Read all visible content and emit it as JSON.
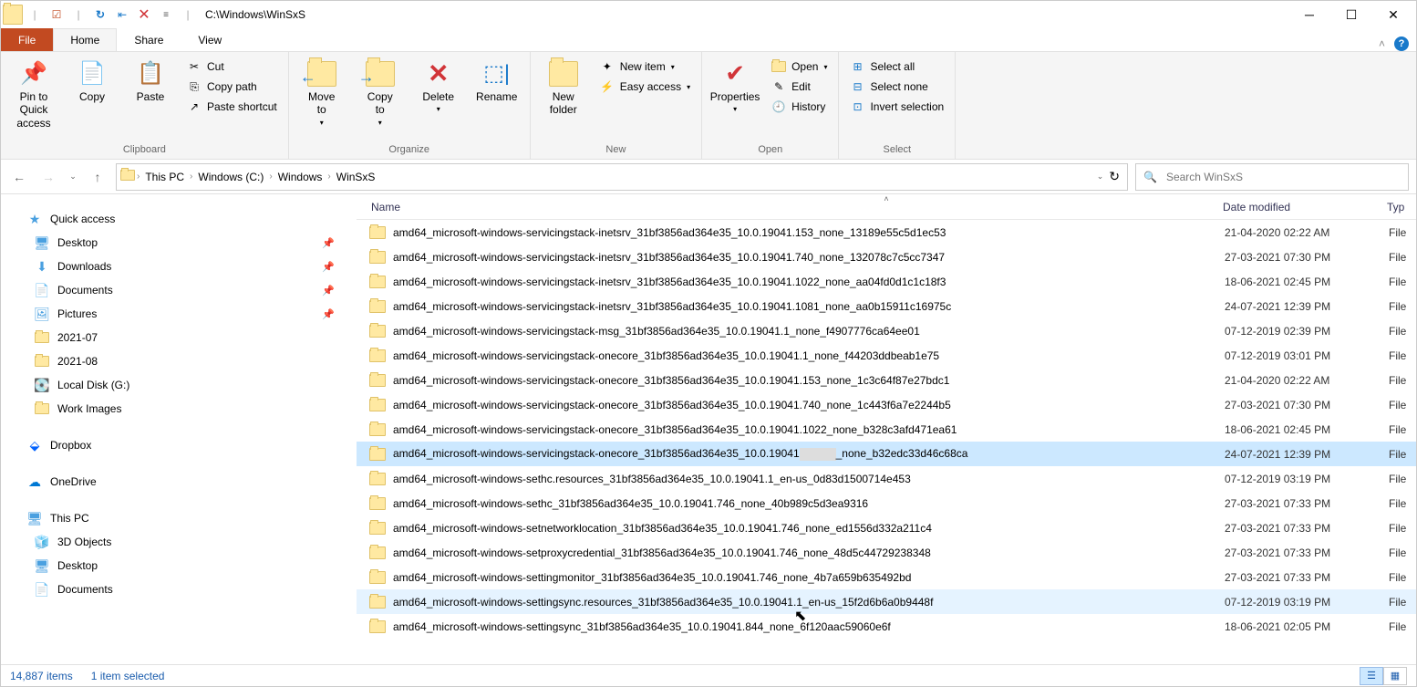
{
  "window": {
    "title_path": "C:\\Windows\\WinSxS"
  },
  "tabs": {
    "file": "File",
    "home": "Home",
    "share": "Share",
    "view": "View"
  },
  "ribbon": {
    "clipboard": {
      "label": "Clipboard",
      "pin": "Pin to Quick\naccess",
      "copy": "Copy",
      "paste": "Paste",
      "cut": "Cut",
      "copypath": "Copy path",
      "pasteshort": "Paste shortcut"
    },
    "organize": {
      "label": "Organize",
      "moveto": "Move\nto",
      "copyto": "Copy\nto",
      "delete": "Delete",
      "rename": "Rename"
    },
    "new": {
      "label": "New",
      "newfolder": "New\nfolder",
      "newitem": "New item",
      "easyaccess": "Easy access"
    },
    "open": {
      "label": "Open",
      "properties": "Properties",
      "open": "Open",
      "edit": "Edit",
      "history": "History"
    },
    "select": {
      "label": "Select",
      "all": "Select all",
      "none": "Select none",
      "invert": "Invert selection"
    }
  },
  "breadcrumb": [
    "This PC",
    "Windows (C:)",
    "Windows",
    "WinSxS"
  ],
  "search_placeholder": "Search WinSxS",
  "nav": {
    "quick": "Quick access",
    "pinned": [
      "Desktop",
      "Downloads",
      "Documents",
      "Pictures"
    ],
    "recent": [
      "2021-07",
      "2021-08",
      "Local Disk (G:)",
      "Work Images"
    ],
    "dropbox": "Dropbox",
    "onedrive": "OneDrive",
    "thispc": "This PC",
    "pcitems": [
      "3D Objects",
      "Desktop",
      "Documents"
    ]
  },
  "cols": {
    "name": "Name",
    "date": "Date modified",
    "type": "Typ"
  },
  "files": [
    {
      "n": "amd64_microsoft-windows-servicingstack-inetsrv_31bf3856ad364e35_10.0.19041.153_none_13189e55c5d1ec53",
      "d": "21-04-2020 02:22 AM",
      "t": "File"
    },
    {
      "n": "amd64_microsoft-windows-servicingstack-inetsrv_31bf3856ad364e35_10.0.19041.740_none_132078c7c5cc7347",
      "d": "27-03-2021 07:30 PM",
      "t": "File"
    },
    {
      "n": "amd64_microsoft-windows-servicingstack-inetsrv_31bf3856ad364e35_10.0.19041.1022_none_aa04fd0d1c1c18f3",
      "d": "18-06-2021 02:45 PM",
      "t": "File"
    },
    {
      "n": "amd64_microsoft-windows-servicingstack-inetsrv_31bf3856ad364e35_10.0.19041.1081_none_aa0b15911c16975c",
      "d": "24-07-2021 12:39 PM",
      "t": "File"
    },
    {
      "n": "amd64_microsoft-windows-servicingstack-msg_31bf3856ad364e35_10.0.19041.1_none_f4907776ca64ee01",
      "d": "07-12-2019 02:39 PM",
      "t": "File"
    },
    {
      "n": "amd64_microsoft-windows-servicingstack-onecore_31bf3856ad364e35_10.0.19041.1_none_f44203ddbeab1e75",
      "d": "07-12-2019 03:01 PM",
      "t": "File"
    },
    {
      "n": "amd64_microsoft-windows-servicingstack-onecore_31bf3856ad364e35_10.0.19041.153_none_1c3c64f87e27bdc1",
      "d": "21-04-2020 02:22 AM",
      "t": "File"
    },
    {
      "n": "amd64_microsoft-windows-servicingstack-onecore_31bf3856ad364e35_10.0.19041.740_none_1c443f6a7e2244b5",
      "d": "27-03-2021 07:30 PM",
      "t": "File"
    },
    {
      "n": "amd64_microsoft-windows-servicingstack-onecore_31bf3856ad364e35_10.0.19041.1022_none_b328c3afd471ea61",
      "d": "18-06-2021 02:45 PM",
      "t": "File"
    },
    {
      "n": "amd64_microsoft-windows-servicingstack-onecore_31bf3856ad364e35_10.0.19041",
      "d": "24-07-2021 12:39 PM",
      "t": "File",
      "sel": true,
      "mask": "_none_b32edc33d46c68ca"
    },
    {
      "n": "amd64_microsoft-windows-sethc.resources_31bf3856ad364e35_10.0.19041.1_en-us_0d83d1500714e453",
      "d": "07-12-2019 03:19 PM",
      "t": "File"
    },
    {
      "n": "amd64_microsoft-windows-sethc_31bf3856ad364e35_10.0.19041.746_none_40b989c5d3ea9316",
      "d": "27-03-2021 07:33 PM",
      "t": "File"
    },
    {
      "n": "amd64_microsoft-windows-setnetworklocation_31bf3856ad364e35_10.0.19041.746_none_ed1556d332a211c4",
      "d": "27-03-2021 07:33 PM",
      "t": "File"
    },
    {
      "n": "amd64_microsoft-windows-setproxycredential_31bf3856ad364e35_10.0.19041.746_none_48d5c44729238348",
      "d": "27-03-2021 07:33 PM",
      "t": "File"
    },
    {
      "n": "amd64_microsoft-windows-settingmonitor_31bf3856ad364e35_10.0.19041.746_none_4b7a659b635492bd",
      "d": "27-03-2021 07:33 PM",
      "t": "File"
    },
    {
      "n": "amd64_microsoft-windows-settingsync.resources_31bf3856ad364e35_10.0.19041.1_en-us_15f2d6b6a0b9448f",
      "d": "07-12-2019 03:19 PM",
      "t": "File",
      "hover": true
    },
    {
      "n": "amd64_microsoft-windows-settingsync_31bf3856ad364e35_10.0.19041.844_none_6f120aac59060e6f",
      "d": "18-06-2021 02:05 PM",
      "t": "File"
    }
  ],
  "status": {
    "items": "14,887 items",
    "selected": "1 item selected"
  }
}
